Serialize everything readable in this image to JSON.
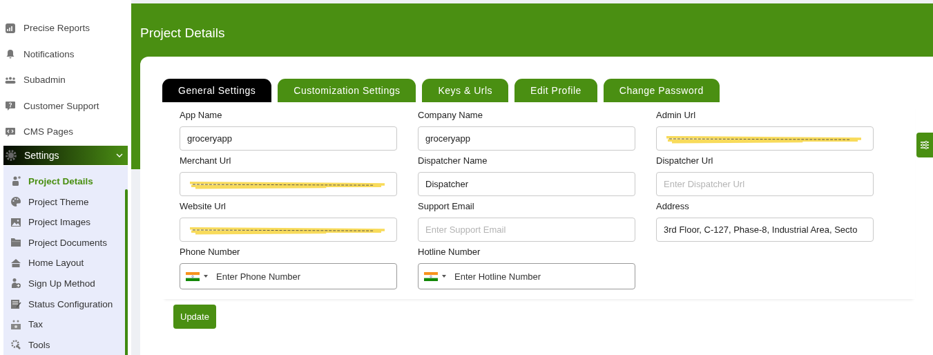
{
  "sidebar": {
    "items": [
      {
        "label": "Precise Reports"
      },
      {
        "label": "Notifications"
      },
      {
        "label": "Subadmin"
      },
      {
        "label": "Customer Support"
      },
      {
        "label": "CMS Pages"
      }
    ],
    "settings": {
      "label": "Settings",
      "expanded": true,
      "children": [
        {
          "label": "Project Details",
          "selected": true
        },
        {
          "label": "Project Theme",
          "selected": false
        },
        {
          "label": "Project Images",
          "selected": false
        },
        {
          "label": "Project Documents",
          "selected": false
        },
        {
          "label": "Home Layout",
          "selected": false
        },
        {
          "label": "Sign Up Method",
          "selected": false
        },
        {
          "label": "Status Configuration",
          "selected": false
        },
        {
          "label": "Tax",
          "selected": false
        },
        {
          "label": "Tools",
          "selected": false
        }
      ]
    }
  },
  "page_title": "Project Details",
  "tabs": [
    {
      "label": "General Settings",
      "selected": true
    },
    {
      "label": "Customization Settings",
      "selected": false
    },
    {
      "label": "Keys & Urls",
      "selected": false
    },
    {
      "label": "Edit Profile",
      "selected": false
    },
    {
      "label": "Change Password",
      "selected": false
    }
  ],
  "fields": [
    {
      "kind": "text",
      "label": "App Name",
      "value": "groceryapp"
    },
    {
      "kind": "text",
      "label": "Company Name",
      "value": "groceryapp"
    },
    {
      "kind": "text",
      "label": "Admin Url",
      "redacted": true
    },
    {
      "kind": "text",
      "label": "Merchant Url",
      "redacted": true
    },
    {
      "kind": "text",
      "label": "Dispatcher Name",
      "value": "Dispatcher"
    },
    {
      "kind": "text",
      "label": "Dispatcher Url",
      "placeholder": "Enter Dispatcher Url"
    },
    {
      "kind": "text",
      "label": "Website Url",
      "redacted": true
    },
    {
      "kind": "text",
      "label": "Support Email",
      "placeholder": "Enter Support Email"
    },
    {
      "kind": "text",
      "label": "Address",
      "value": "3rd Floor, C-127, Phase-8, Industrial Area, Secto"
    },
    {
      "kind": "phone",
      "label": "Phone Number",
      "placeholder": "Enter Phone Number"
    },
    {
      "kind": "phone",
      "label": "Hotline Number",
      "placeholder": "Enter Hotline Number"
    }
  ],
  "update_button": "Update"
}
